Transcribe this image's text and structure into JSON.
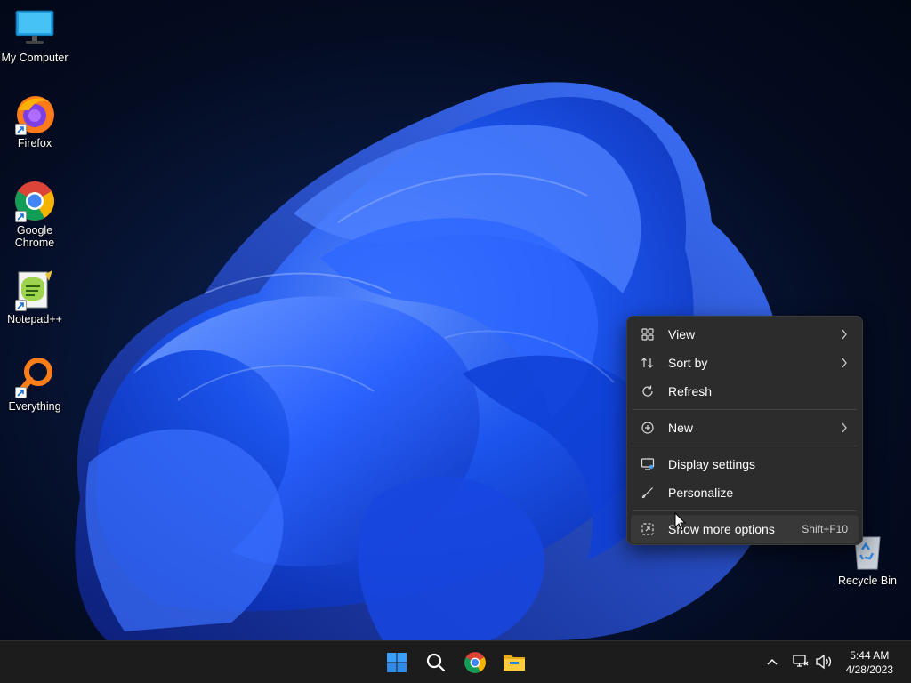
{
  "desktop": {
    "icons": [
      {
        "label": "My Computer"
      },
      {
        "label": "Firefox"
      },
      {
        "label": "Google Chrome"
      },
      {
        "label": "Notepad++"
      },
      {
        "label": "Everything"
      }
    ],
    "recycle_bin": {
      "label": "Recycle Bin"
    }
  },
  "context_menu": {
    "items": [
      {
        "label": "View",
        "icon": "grid-icon",
        "has_submenu": true
      },
      {
        "label": "Sort by",
        "icon": "sort-icon",
        "has_submenu": true
      },
      {
        "label": "Refresh",
        "icon": "refresh-icon",
        "has_submenu": false
      },
      {
        "label": "New",
        "icon": "plus-circle-icon",
        "has_submenu": true
      },
      {
        "label": "Display settings",
        "icon": "display-icon",
        "has_submenu": false
      },
      {
        "label": "Personalize",
        "icon": "brush-icon",
        "has_submenu": false
      },
      {
        "label": "Show more options",
        "icon": "expand-icon",
        "shortcut": "Shift+F10",
        "highlighted": true
      }
    ]
  },
  "taskbar": {
    "apps": [
      "start-icon",
      "search-icon",
      "chrome-icon",
      "file-explorer-icon"
    ],
    "tray": [
      "chevron-up-icon",
      "network-icon",
      "volume-icon"
    ],
    "clock": {
      "time": "5:44 AM",
      "date": "4/28/2023"
    }
  },
  "colors": {
    "accent": "#1a5cff",
    "menu_bg": "#2c2c2c",
    "taskbar_bg": "#1c1c1c"
  }
}
